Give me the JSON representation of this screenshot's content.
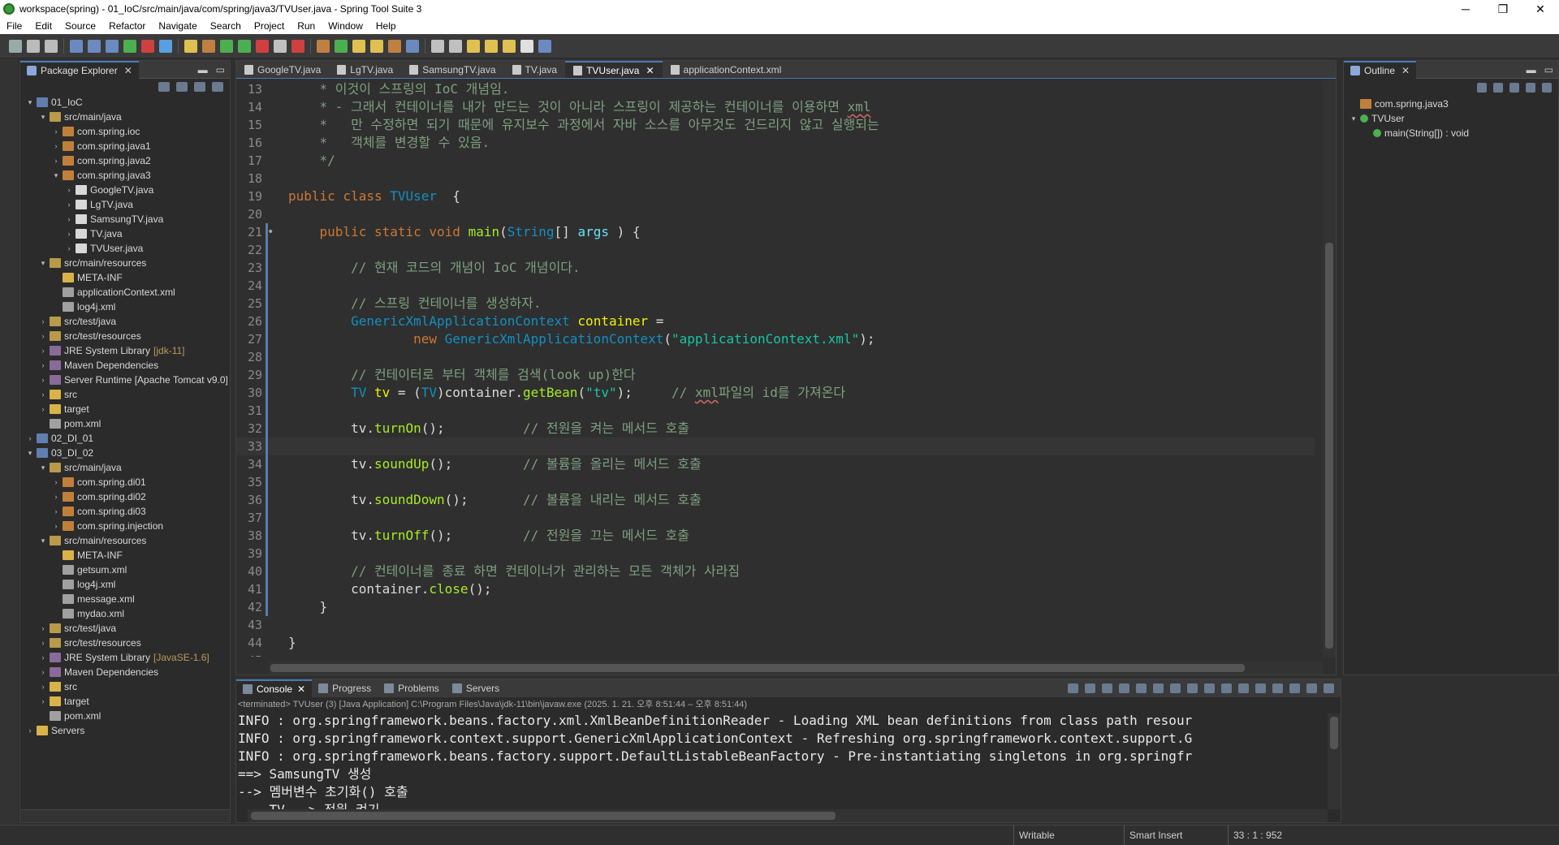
{
  "window": {
    "title": "workspace(spring) - 01_IoC/src/main/java/com/spring/java3/TVUser.java - Spring Tool Suite 3",
    "minimize": "─",
    "restore": "❐",
    "close": "✕"
  },
  "menu": [
    "File",
    "Edit",
    "Source",
    "Refactor",
    "Navigate",
    "Search",
    "Project",
    "Run",
    "Window",
    "Help"
  ],
  "package_explorer": {
    "title": "Package Explorer",
    "tree": [
      {
        "level": 0,
        "arrow": "▾",
        "icon": "proj",
        "label": "01_IoC"
      },
      {
        "level": 1,
        "arrow": "▾",
        "icon": "srcf",
        "label": "src/main/java"
      },
      {
        "level": 2,
        "arrow": "›",
        "icon": "pkg",
        "label": "com.spring.ioc"
      },
      {
        "level": 2,
        "arrow": "›",
        "icon": "pkg",
        "label": "com.spring.java1"
      },
      {
        "level": 2,
        "arrow": "›",
        "icon": "pkg",
        "label": "com.spring.java2"
      },
      {
        "level": 2,
        "arrow": "▾",
        "icon": "pkg",
        "label": "com.spring.java3"
      },
      {
        "level": 3,
        "arrow": "›",
        "icon": "java",
        "label": "GoogleTV.java"
      },
      {
        "level": 3,
        "arrow": "›",
        "icon": "java",
        "label": "LgTV.java"
      },
      {
        "level": 3,
        "arrow": "›",
        "icon": "java",
        "label": "SamsungTV.java"
      },
      {
        "level": 3,
        "arrow": "›",
        "icon": "java",
        "label": "TV.java"
      },
      {
        "level": 3,
        "arrow": "›",
        "icon": "java",
        "label": "TVUser.java"
      },
      {
        "level": 1,
        "arrow": "▾",
        "icon": "srcf",
        "label": "src/main/resources"
      },
      {
        "level": 2,
        "arrow": "",
        "icon": "fold",
        "label": "META-INF"
      },
      {
        "level": 2,
        "arrow": "",
        "icon": "xml",
        "label": "applicationContext.xml"
      },
      {
        "level": 2,
        "arrow": "",
        "icon": "xml",
        "label": "log4j.xml"
      },
      {
        "level": 1,
        "arrow": "›",
        "icon": "srcf",
        "label": "src/test/java"
      },
      {
        "level": 1,
        "arrow": "›",
        "icon": "srcf",
        "label": "src/test/resources"
      },
      {
        "level": 1,
        "arrow": "›",
        "icon": "lib",
        "label": "JRE System Library",
        "dec": "[jdk-11]"
      },
      {
        "level": 1,
        "arrow": "›",
        "icon": "lib",
        "label": "Maven Dependencies"
      },
      {
        "level": 1,
        "arrow": "›",
        "icon": "lib",
        "label": "Server Runtime [Apache Tomcat v9.0]"
      },
      {
        "level": 1,
        "arrow": "›",
        "icon": "fold",
        "label": "src"
      },
      {
        "level": 1,
        "arrow": "›",
        "icon": "fold",
        "label": "target"
      },
      {
        "level": 1,
        "arrow": "",
        "icon": "xml",
        "label": "pom.xml"
      },
      {
        "level": 0,
        "arrow": "›",
        "icon": "proj",
        "label": "02_DI_01"
      },
      {
        "level": 0,
        "arrow": "▾",
        "icon": "proj",
        "label": "03_DI_02"
      },
      {
        "level": 1,
        "arrow": "▾",
        "icon": "srcf",
        "label": "src/main/java"
      },
      {
        "level": 2,
        "arrow": "›",
        "icon": "pkg",
        "label": "com.spring.di01"
      },
      {
        "level": 2,
        "arrow": "›",
        "icon": "pkg",
        "label": "com.spring.di02"
      },
      {
        "level": 2,
        "arrow": "›",
        "icon": "pkg",
        "label": "com.spring.di03"
      },
      {
        "level": 2,
        "arrow": "›",
        "icon": "pkg",
        "label": "com.spring.injection"
      },
      {
        "level": 1,
        "arrow": "▾",
        "icon": "srcf",
        "label": "src/main/resources"
      },
      {
        "level": 2,
        "arrow": "",
        "icon": "fold",
        "label": "META-INF"
      },
      {
        "level": 2,
        "arrow": "",
        "icon": "xml",
        "label": "getsum.xml"
      },
      {
        "level": 2,
        "arrow": "",
        "icon": "xml",
        "label": "log4j.xml"
      },
      {
        "level": 2,
        "arrow": "",
        "icon": "xml",
        "label": "message.xml"
      },
      {
        "level": 2,
        "arrow": "",
        "icon": "xml",
        "label": "mydao.xml"
      },
      {
        "level": 1,
        "arrow": "›",
        "icon": "srcf",
        "label": "src/test/java"
      },
      {
        "level": 1,
        "arrow": "›",
        "icon": "srcf",
        "label": "src/test/resources"
      },
      {
        "level": 1,
        "arrow": "›",
        "icon": "lib",
        "label": "JRE System Library",
        "dec": "[JavaSE-1.6]"
      },
      {
        "level": 1,
        "arrow": "›",
        "icon": "lib",
        "label": "Maven Dependencies"
      },
      {
        "level": 1,
        "arrow": "›",
        "icon": "fold",
        "label": "src"
      },
      {
        "level": 1,
        "arrow": "›",
        "icon": "fold",
        "label": "target"
      },
      {
        "level": 1,
        "arrow": "",
        "icon": "xml",
        "label": "pom.xml"
      },
      {
        "level": 0,
        "arrow": "›",
        "icon": "fold",
        "label": "Servers"
      }
    ]
  },
  "editor": {
    "tabs": [
      {
        "label": "GoogleTV.java",
        "active": false
      },
      {
        "label": "LgTV.java",
        "active": false
      },
      {
        "label": "SamsungTV.java",
        "active": false
      },
      {
        "label": "TV.java",
        "active": false
      },
      {
        "label": "TVUser.java",
        "active": true
      },
      {
        "label": "applicationContext.xml",
        "active": false
      }
    ],
    "current_line": 33,
    "lines": [
      {
        "n": "13",
        "t": [
          [
            "cmt",
            "    * 이것이 스프링의 IoC 개념임."
          ]
        ]
      },
      {
        "n": "14",
        "t": [
          [
            "cmt",
            "    * - 그래서 컨테이너를 내가 만드는 것이 아니라 스프링이 제공하는 컨테이너를 이용하면 "
          ],
          [
            "cmt spell",
            "xml"
          ]
        ]
      },
      {
        "n": "15",
        "t": [
          [
            "cmt",
            "    *   만 수정하면 되기 때문에 유지보수 과정에서 자바 소스를 아무것도 건드리지 않고 실행되는"
          ]
        ]
      },
      {
        "n": "16",
        "t": [
          [
            "cmt",
            "    *   객체를 변경할 수 있음."
          ]
        ]
      },
      {
        "n": "17",
        "t": [
          [
            "cmt",
            "    */"
          ]
        ]
      },
      {
        "n": "18",
        "t": []
      },
      {
        "n": "19",
        "t": [
          [
            "kw",
            "public class "
          ],
          [
            "cls",
            "TVUser"
          ],
          [
            "",
            "  {"
          ]
        ]
      },
      {
        "n": "20",
        "t": []
      },
      {
        "n": "21",
        "t": [
          [
            "",
            "    "
          ],
          [
            "kw",
            "public static void "
          ],
          [
            "meth",
            "main"
          ],
          [
            "",
            "("
          ],
          [
            "cls",
            "String"
          ],
          [
            "",
            "[] "
          ],
          [
            "fld",
            "args"
          ],
          [
            "",
            " ) {"
          ]
        ]
      },
      {
        "n": "22",
        "t": []
      },
      {
        "n": "23",
        "t": [
          [
            "",
            "        "
          ],
          [
            "cmt",
            "// 현재 코드의 개념이 IoC 개념이다."
          ]
        ]
      },
      {
        "n": "24",
        "t": []
      },
      {
        "n": "25",
        "t": [
          [
            "",
            "        "
          ],
          [
            "cmt",
            "// 스프링 컨테이너를 생성하자."
          ]
        ]
      },
      {
        "n": "26",
        "t": [
          [
            "",
            "        "
          ],
          [
            "cls",
            "GenericXmlApplicationContext "
          ],
          [
            "var",
            "container"
          ],
          [
            "",
            " ="
          ]
        ]
      },
      {
        "n": "27",
        "t": [
          [
            "",
            "                "
          ],
          [
            "kw",
            "new "
          ],
          [
            "cls",
            "GenericXmlApplicationContext"
          ],
          [
            "",
            "("
          ],
          [
            "str",
            "\"applicationContext.xml\""
          ],
          [
            "",
            ");"
          ]
        ]
      },
      {
        "n": "28",
        "t": []
      },
      {
        "n": "29",
        "t": [
          [
            "",
            "        "
          ],
          [
            "cmt",
            "// 컨테이터로 부터 객체를 검색(look up)한다"
          ]
        ]
      },
      {
        "n": "30",
        "t": [
          [
            "",
            "        "
          ],
          [
            "cls",
            "TV "
          ],
          [
            "var",
            "tv"
          ],
          [
            "",
            " = ("
          ],
          [
            "cls",
            "TV"
          ],
          [
            "",
            ")container."
          ],
          [
            "meth",
            "getBean"
          ],
          [
            "",
            "("
          ],
          [
            "str",
            "\"tv\""
          ],
          [
            "",
            ");     "
          ],
          [
            "cmt",
            "// "
          ],
          [
            "cmt spell",
            "xml"
          ],
          [
            "cmt",
            "파일의 id를 가져온다"
          ]
        ]
      },
      {
        "n": "31",
        "t": []
      },
      {
        "n": "32",
        "t": [
          [
            "",
            "        tv."
          ],
          [
            "meth",
            "turnOn"
          ],
          [
            "",
            "();          "
          ],
          [
            "cmt",
            "// 전원을 켜는 메서드 호출"
          ]
        ]
      },
      {
        "n": "33",
        "t": []
      },
      {
        "n": "34",
        "t": [
          [
            "",
            "        tv."
          ],
          [
            "meth",
            "soundUp"
          ],
          [
            "",
            "();         "
          ],
          [
            "cmt",
            "// 볼륨을 올리는 메서드 호출"
          ]
        ]
      },
      {
        "n": "35",
        "t": []
      },
      {
        "n": "36",
        "t": [
          [
            "",
            "        tv."
          ],
          [
            "meth",
            "soundDown"
          ],
          [
            "",
            "();       "
          ],
          [
            "cmt",
            "// 볼륨을 내리는 메서드 호출"
          ]
        ]
      },
      {
        "n": "37",
        "t": []
      },
      {
        "n": "38",
        "t": [
          [
            "",
            "        tv."
          ],
          [
            "meth",
            "turnOff"
          ],
          [
            "",
            "();         "
          ],
          [
            "cmt",
            "// 전원을 끄는 메서드 호출"
          ]
        ]
      },
      {
        "n": "39",
        "t": []
      },
      {
        "n": "40",
        "t": [
          [
            "",
            "        "
          ],
          [
            "cmt",
            "// 컨테이너를 종료 하면 컨테이너가 관리하는 모든 객체가 사라짐"
          ]
        ]
      },
      {
        "n": "41",
        "t": [
          [
            "",
            "        container."
          ],
          [
            "meth",
            "close"
          ],
          [
            "",
            "();"
          ]
        ]
      },
      {
        "n": "42",
        "t": [
          [
            "",
            "    }"
          ]
        ]
      },
      {
        "n": "43",
        "t": []
      },
      {
        "n": "44",
        "t": [
          [
            "",
            "}"
          ]
        ]
      },
      {
        "n": "45",
        "t": []
      }
    ]
  },
  "outline": {
    "title": "Outline",
    "items": [
      {
        "level": 0,
        "arrow": "",
        "icon": "pkg",
        "label": "com.spring.java3"
      },
      {
        "level": 0,
        "arrow": "▾",
        "icon": "cls",
        "label": "TVUser"
      },
      {
        "level": 1,
        "arrow": "",
        "icon": "meth",
        "label": "main(String[]) : void"
      }
    ]
  },
  "console": {
    "tabs": [
      {
        "label": "Console",
        "active": true
      },
      {
        "label": "Progress",
        "active": false
      },
      {
        "label": "Problems",
        "active": false
      },
      {
        "label": "Servers",
        "active": false
      }
    ],
    "terminated": "<terminated> TVUser (3) [Java Application] C:\\Program Files\\Java\\jdk-11\\bin\\javaw.exe  (2025. 1. 21. 오후 8:51:44 – 오후 8:51:44)",
    "lines": [
      "INFO : org.springframework.beans.factory.xml.XmlBeanDefinitionReader - Loading XML bean definitions from class path resour",
      "INFO : org.springframework.context.support.GenericXmlApplicationContext - Refreshing org.springframework.context.support.G",
      "INFO : org.springframework.beans.factory.support.DefaultListableBeanFactory - Pre-instantiating singletons in org.springfr",
      "==> SamsungTV 생성",
      "--> 멤버변수 초기화() 호출",
      "--- TV --> 전원 켜기"
    ]
  },
  "status": {
    "writable": "Writable",
    "insert_mode": "Smart Insert",
    "position": "33 : 1 : 952"
  }
}
